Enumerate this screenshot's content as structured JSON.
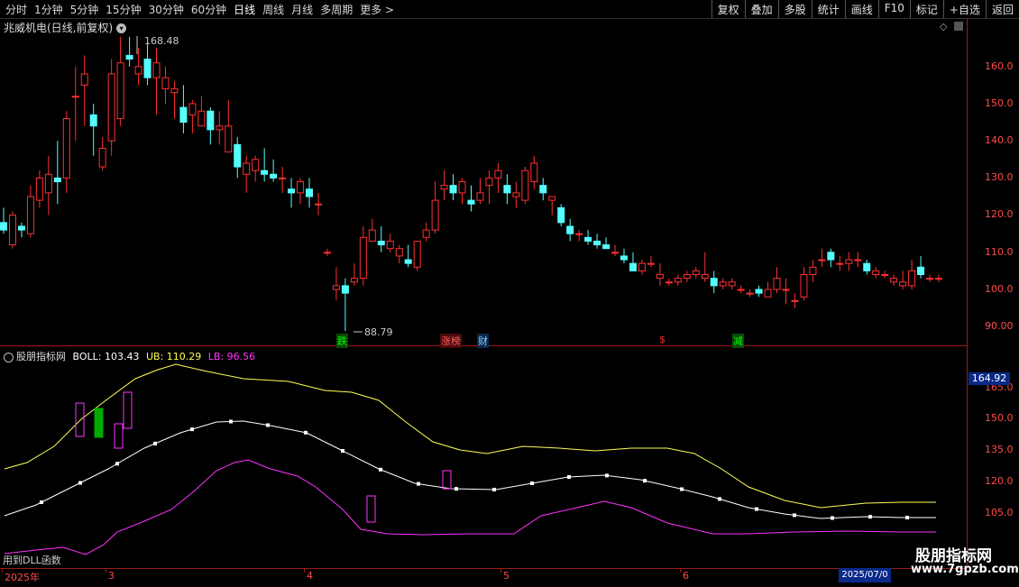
{
  "toolbar": {
    "periods": [
      "分时",
      "1分钟",
      "5分钟",
      "15分钟",
      "30分钟",
      "60分钟",
      "日线",
      "周线",
      "月线",
      "多周期",
      "更多 >"
    ],
    "active": "日线",
    "buttons": [
      "复权",
      "叠加",
      "多股",
      "统计",
      "画线",
      "F10",
      "标记",
      "+自选",
      "返回"
    ]
  },
  "main": {
    "title": "兆威机电(日线,前复权)",
    "high_label": "168.48",
    "low_label": "88.79",
    "y_labels": [
      "160.0",
      "150.0",
      "140.0",
      "130.0",
      "120.0",
      "110.0",
      "100.0",
      "90.00"
    ],
    "markers": [
      {
        "text": "跌",
        "color": "#00ff00",
        "bg": "#0a4a0a"
      },
      {
        "text": "涨榜",
        "color": "#ff6060",
        "bg": "#4a0a0a"
      },
      {
        "text": "财",
        "color": "#88ccff",
        "bg": "#0a2a4a"
      },
      {
        "text": "$",
        "color": "#ff3030",
        "bg": ""
      },
      {
        "text": "减",
        "color": "#00ff00",
        "bg": "#0a4a0a"
      }
    ]
  },
  "indicator": {
    "name": "股朋指标网",
    "boll_label": "BOLL: 103.43",
    "ub_label": "UB: 110.29",
    "lb_label": "LB: 96.56",
    "y_labels": [
      "165.0",
      "150.0",
      "135.0",
      "120.0",
      "105.0"
    ],
    "current_value": "164.92",
    "colors": {
      "boll": "#ffffff",
      "ub": "#ffff55",
      "lb": "#ff33ff"
    }
  },
  "date_axis": {
    "labels": [
      "2025年",
      "3",
      "4",
      "5",
      "6"
    ],
    "current": "2025/07/0"
  },
  "watermark": {
    "title": "股朋指标网",
    "url": "www.7gpzb.com"
  },
  "footer_note": "用到DLL函数"
}
